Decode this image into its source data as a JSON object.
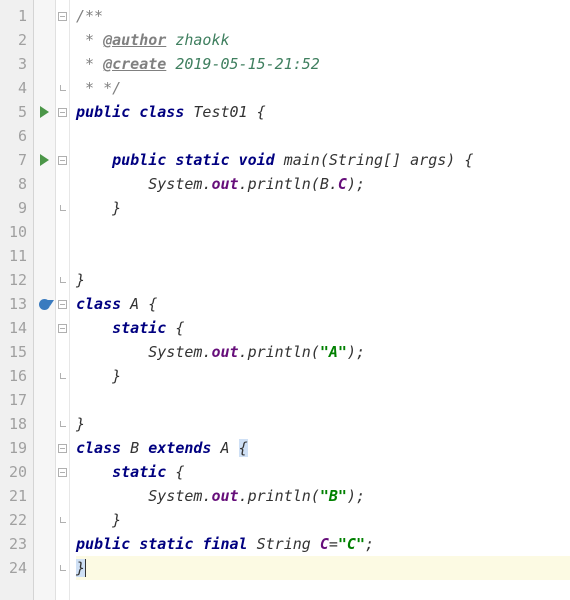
{
  "lines": {
    "l1": [
      "1",
      "2",
      "3",
      "4",
      "5",
      "6",
      "7",
      "8",
      "9",
      "10",
      "11",
      "12",
      "13",
      "14",
      "15",
      "16",
      "17",
      "18",
      "19",
      "20",
      "21",
      "22",
      "23",
      "24"
    ]
  },
  "doc": {
    "open": "/**",
    "author_tag": "@author",
    "author_val": " zhaokk",
    "create_tag": "@create",
    "create_val": " 2019-05-15-21:52",
    "close": "*/",
    "star": " * "
  },
  "c5a": "public",
  "c5b": " class",
  "c5c": " Test01 {",
  "c7a": "public",
  "c7b": " static",
  "c7c": " void",
  "c7d": " main(String[] args) {",
  "c8a": "System.",
  "c8b": "out",
  "c8c": ".println(B.",
  "c8d": "C",
  "c8e": ");",
  "c9": "}",
  "c12": "}",
  "c13a": "class",
  "c13b": " A {",
  "c14a": "static",
  "c14b": " {",
  "c15a": "System.",
  "c15b": "out",
  "c15c": ".println(",
  "c15d": "\"A\"",
  "c15e": ");",
  "c16": "}",
  "c18": "}",
  "c19a": "class",
  "c19b": " B ",
  "c19c": "extends",
  "c19d": " A ",
  "c19e": "{",
  "c20a": "static",
  "c20b": " {",
  "c21a": "System.",
  "c21b": "out",
  "c21c": ".println(",
  "c21d": "\"B\"",
  "c21e": ");",
  "c22": "}",
  "c23a": "public",
  "c23b": " static",
  "c23c": " final",
  "c23d": " String ",
  "c23e": "C",
  "c23f": "=",
  "c23g": "\"C\"",
  "c23h": ";",
  "c24": "}"
}
